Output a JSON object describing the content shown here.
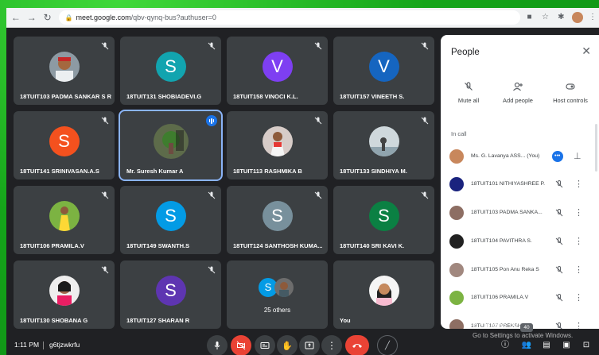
{
  "browser": {
    "url_host": "meet.google.com",
    "url_path": "/qbv-qynq-bus?authuser=0"
  },
  "tiles": [
    {
      "name": "18TUIT103 PADMA SANKAR S R"
    },
    {
      "name": "18TUIT131 SHOBIADEVI.G",
      "initial": "S",
      "color": "#12a4af"
    },
    {
      "name": "18TUIT158 VINOCI K.L.",
      "initial": "V",
      "color": "#7e3ff2"
    },
    {
      "name": "18TUIT157 VINEETH S.",
      "initial": "V",
      "color": "#1565c0"
    },
    {
      "name": "18TUIT141 SRINIVASAN.A.S",
      "initial": "S",
      "color": "#f4511e"
    },
    {
      "name": "Mr. Suresh Kumar A"
    },
    {
      "name": "18TUIT113 RASHMIKA B"
    },
    {
      "name": "18TUIT133 SINDHIYA M."
    },
    {
      "name": "18TUIT106 PRAMILA.V"
    },
    {
      "name": "18TUIT149 SWANTH.S",
      "initial": "S",
      "color": "#039be5"
    },
    {
      "name": "18TUIT124 SANTHOSH KUMA...",
      "initial": "S",
      "color": "#78909c"
    },
    {
      "name": "18TUIT140 SRI KAVI K.",
      "initial": "S",
      "color": "#0b8043"
    },
    {
      "name": "18TUIT130 SHOBANA G"
    },
    {
      "name": "18TUIT127 SHARAN R",
      "initial": "S",
      "color": "#5e35b1"
    },
    {
      "name": "25 others"
    },
    {
      "name": "You"
    }
  ],
  "others_initial": "S",
  "panel": {
    "title": "People",
    "actions": [
      "Mute all",
      "Add people",
      "Host controls"
    ],
    "section": "In call",
    "participants": [
      {
        "name": "Ms. G. Lavanya ASS...",
        "tag": "(You)"
      },
      {
        "name": "18TUIT101 NITHIYASHREE P."
      },
      {
        "name": "18TUIT103 PADMA SANKA..."
      },
      {
        "name": "18TUIT104 PAVITHRA S."
      },
      {
        "name": "18TUIT105 Pon Anu Reka S"
      },
      {
        "name": "18TUIT106 PRAMILA.V"
      },
      {
        "name": "18TUIT107 PREKSHA P"
      }
    ]
  },
  "bottom": {
    "time": "1:11 PM",
    "meeting_code": "g6tjzwkrfu",
    "people_count": "40"
  },
  "watermark": {
    "line1": "Activate Windows",
    "line2": "Go to Settings to activate Windows."
  },
  "colors": {
    "background_green": "#18b21f",
    "meet_dark": "#202124",
    "tile": "#3c4043",
    "end_call": "#ea4335",
    "active_speaker": "#8ab4f8"
  }
}
